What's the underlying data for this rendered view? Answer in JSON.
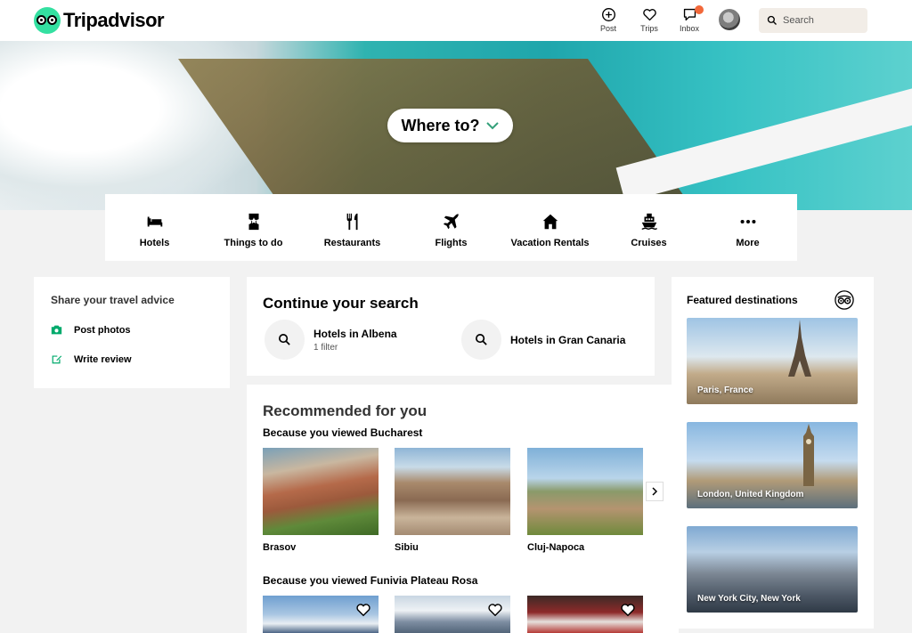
{
  "header": {
    "logo_text": "Tripadvisor",
    "nav": [
      {
        "label": "Post",
        "icon": "plus-circle-icon"
      },
      {
        "label": "Trips",
        "icon": "heart-icon"
      },
      {
        "label": "Inbox",
        "icon": "chat-icon",
        "badge": ""
      }
    ],
    "search_placeholder": "Search"
  },
  "hero": {
    "where_label": "Where to?"
  },
  "categories": [
    {
      "label": "Hotels",
      "icon": "bed-icon"
    },
    {
      "label": "Things to do",
      "icon": "ticket-icon"
    },
    {
      "label": "Restaurants",
      "icon": "fork-knife-icon"
    },
    {
      "label": "Flights",
      "icon": "plane-icon"
    },
    {
      "label": "Vacation Rentals",
      "icon": "house-icon"
    },
    {
      "label": "Cruises",
      "icon": "ship-icon"
    },
    {
      "label": "More",
      "icon": "more-dots-icon"
    }
  ],
  "share": {
    "title": "Share your travel advice",
    "actions": [
      {
        "label": "Post photos",
        "icon": "camera-icon"
      },
      {
        "label": "Write review",
        "icon": "edit-icon"
      }
    ]
  },
  "continue": {
    "title": "Continue your search",
    "items": [
      {
        "title": "Hotels in Albena",
        "subtitle": "1 filter"
      },
      {
        "title": "Hotels in Gran Canaria",
        "subtitle": ""
      }
    ]
  },
  "recommended": {
    "title": "Recommended for you",
    "groups": [
      {
        "subtitle": "Because you viewed Bucharest",
        "items": [
          "Brasov",
          "Sibiu",
          "Cluj-Napoca"
        ]
      },
      {
        "subtitle": "Because you viewed Funivia Plateau Rosa",
        "items": [
          "",
          "",
          ""
        ]
      }
    ]
  },
  "featured": {
    "title": "Featured destinations",
    "items": [
      "Paris, France",
      "London, United Kingdom",
      "New York City, New York"
    ]
  },
  "colors": {
    "brand": "#34e0a1",
    "badge": "#f2683a",
    "search_bg": "#f2ede7",
    "page_bg": "#f2f2f2"
  }
}
